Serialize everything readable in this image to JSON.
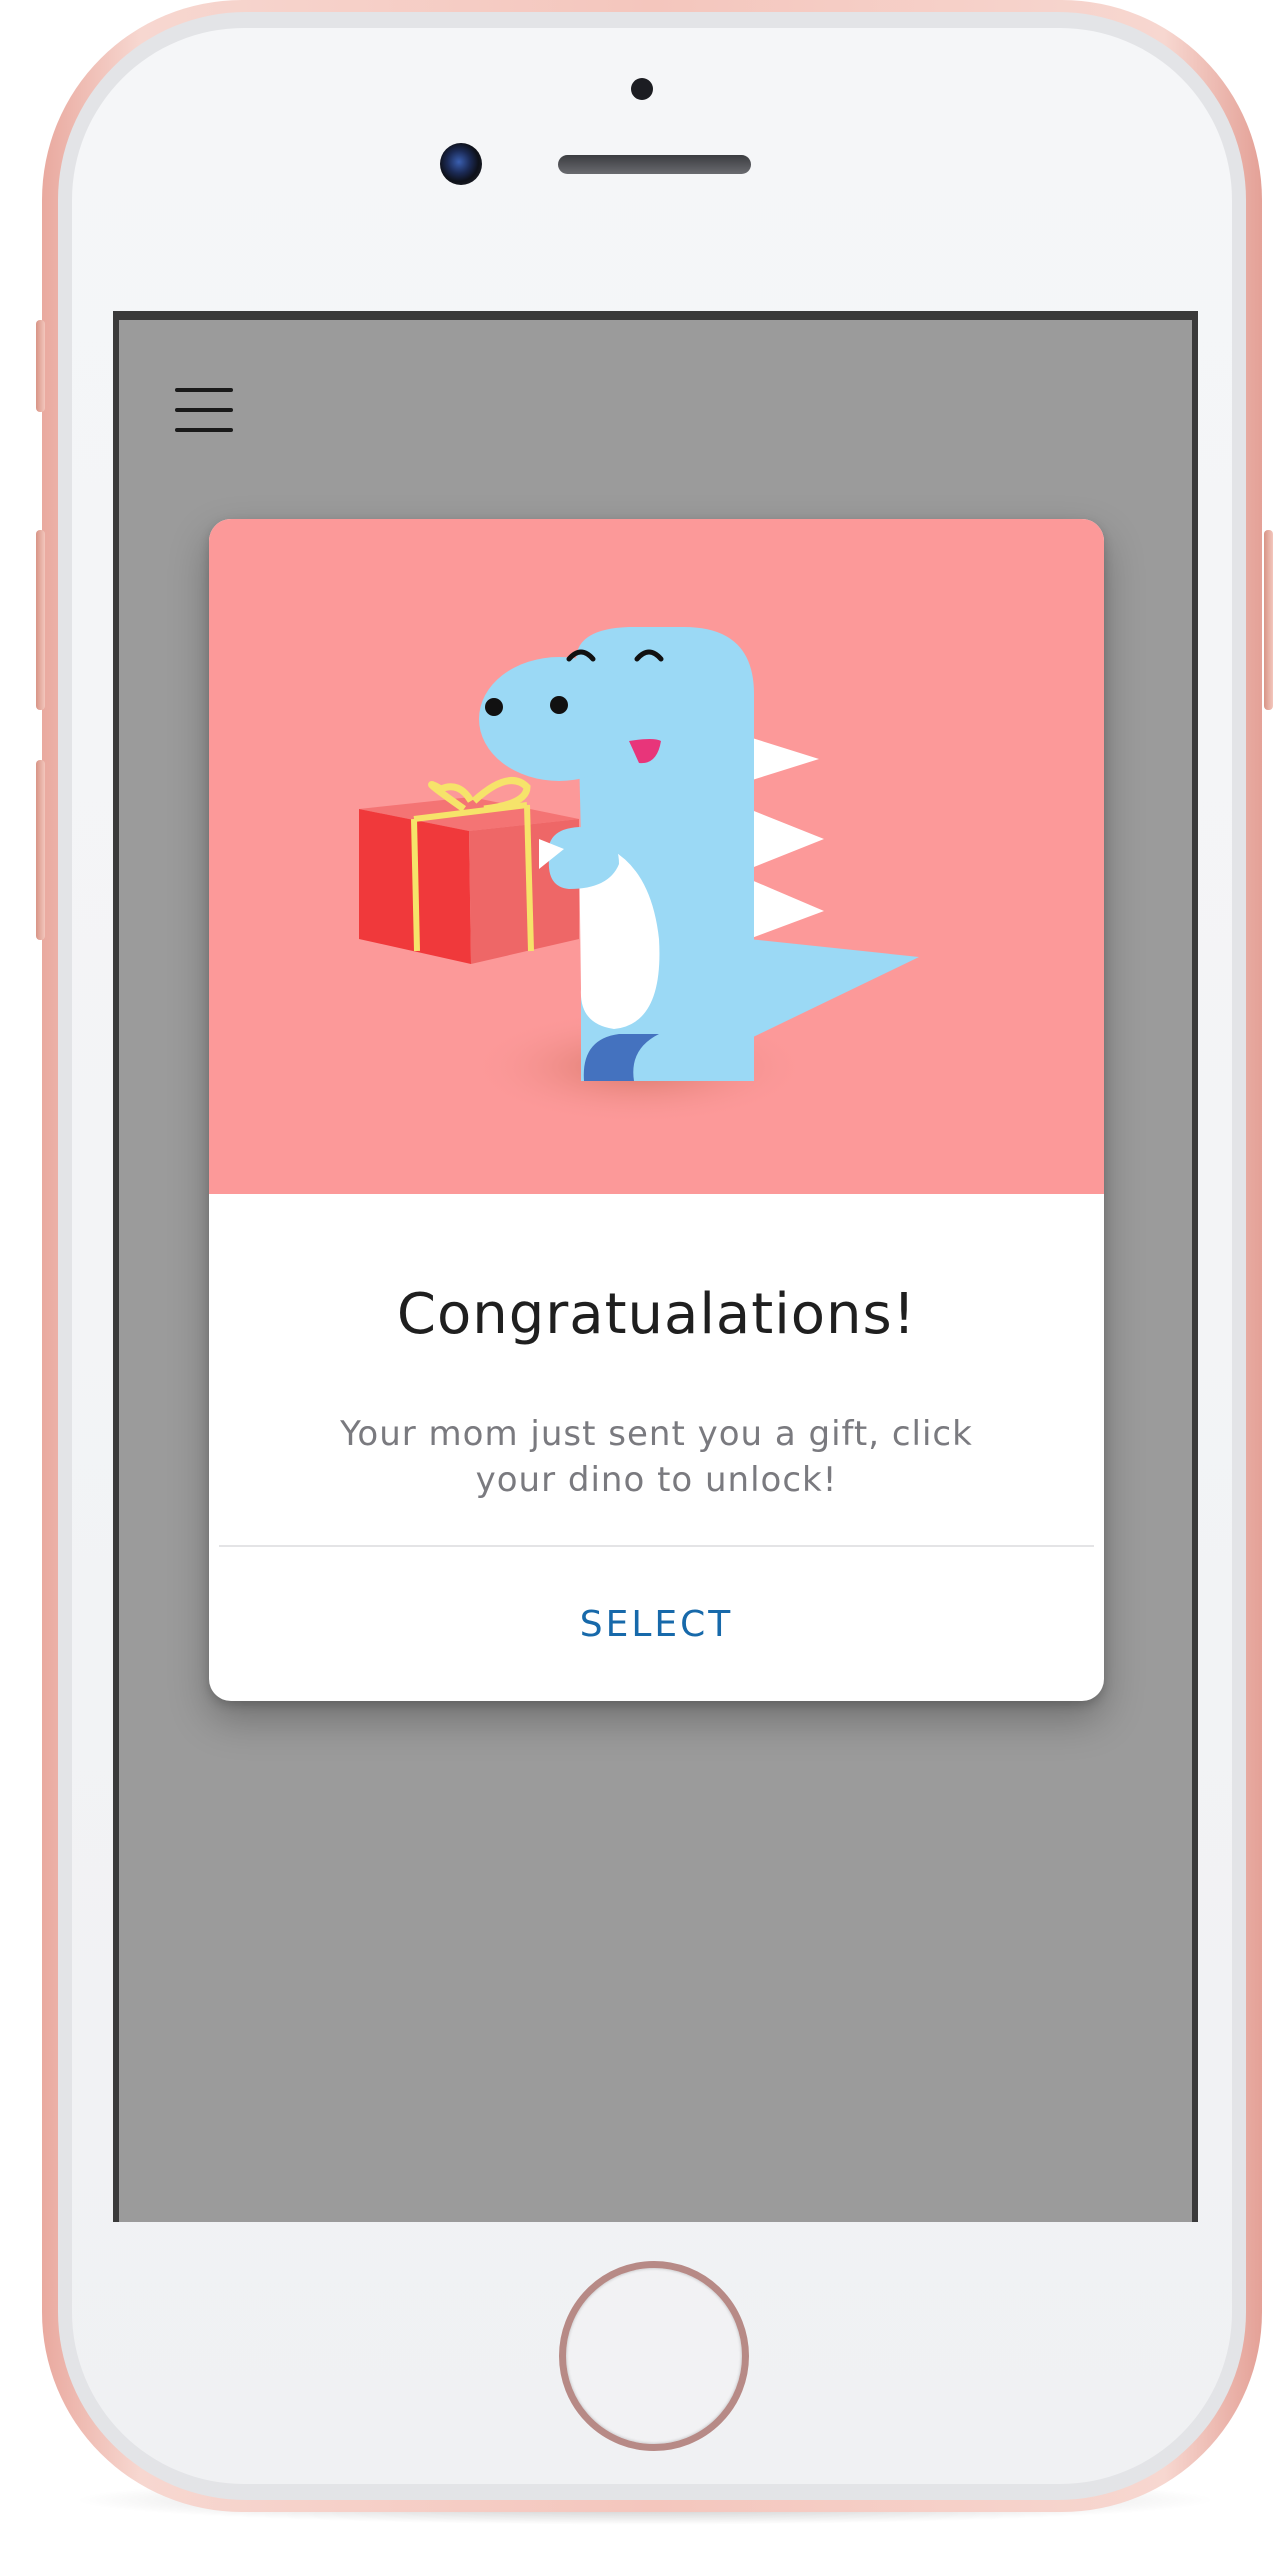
{
  "screen": {
    "background_color": "#9b9b9b",
    "menu_icon": "hamburger-menu-icon"
  },
  "dialog": {
    "hero_background_color": "#fc9999",
    "illustration": "dino-holding-gift",
    "title": "Congratualations!",
    "message": "Your mom just sent you a gift, click your dino to unlock!",
    "action_label": "SELECT",
    "action_color": "#1769aa"
  }
}
